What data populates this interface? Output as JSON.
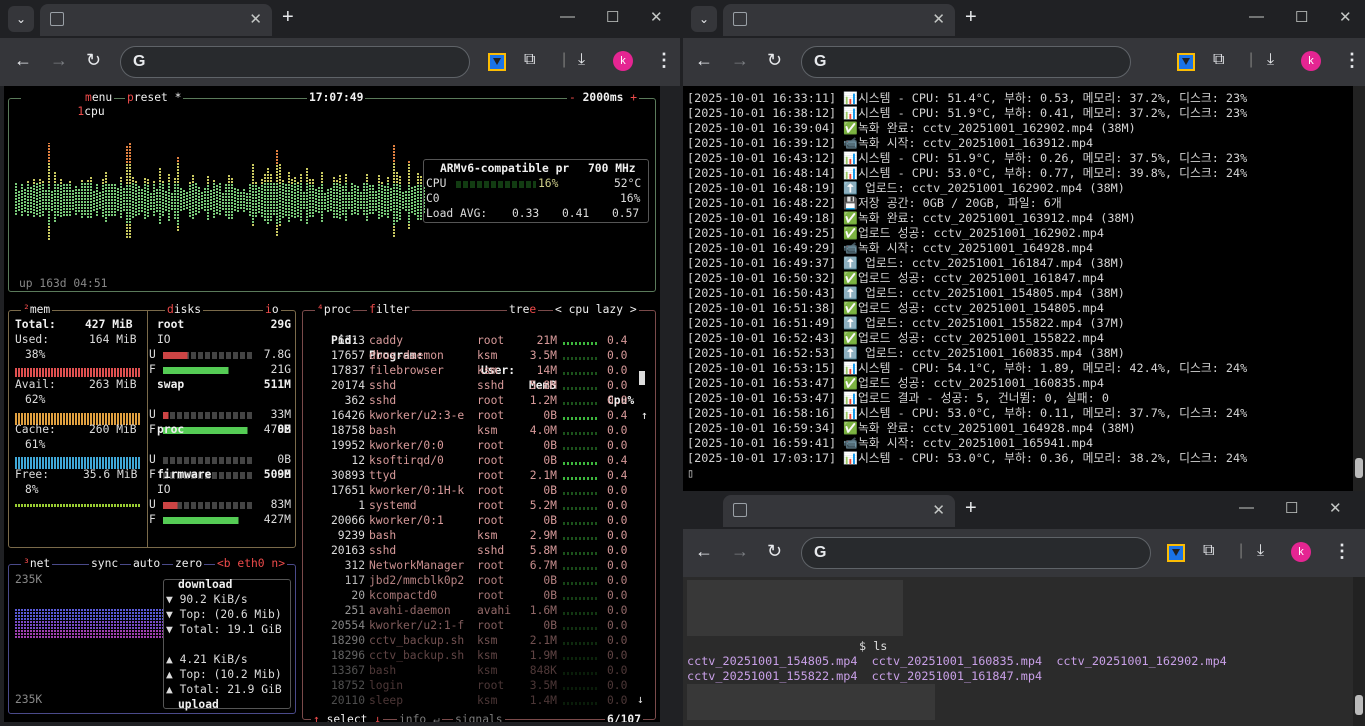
{
  "left_window": {
    "tab_title": "",
    "url": "",
    "avatar_letter": "k",
    "btop": {
      "cpu_header": {
        "box": "cpu",
        "menu": "menu",
        "preset": "preset *",
        "clock": "17:07:49",
        "interval": "2000ms",
        "minus": "-",
        "plus": "+",
        "num": "1"
      },
      "uptime": "up 163d 04:51",
      "cpu_info": {
        "model": "ARMv6-compatible pr",
        "freq": "700 MHz",
        "cpu_label": "CPU",
        "cpu_pct": "16%",
        "cpu_temp": "52°C",
        "c0_label": "C0",
        "c0_pct": "16%",
        "load_label": "Load AVG:",
        "load": [
          "0.33",
          "0.41",
          "0.57"
        ]
      },
      "mem": {
        "num": "²",
        "title": "mem",
        "total_label": "Total:",
        "total": "427 MiB",
        "used_label": "Used:",
        "used": "164 MiB",
        "used_pct": "38%",
        "avail_label": "Avail:",
        "avail": "263 MiB",
        "avail_pct": "62%",
        "cache_label": "Cache:",
        "cache": "260 MiB",
        "cache_pct": "61%",
        "free_label": "Free:",
        "free": "35.6 MiB",
        "free_pct": "8%",
        "fractions": {
          "used": 0.38,
          "avail": 0.62,
          "cache": 0.61,
          "free": 0.08
        }
      },
      "disks": {
        "title": "disks",
        "io": "io",
        "items": [
          {
            "name": "root",
            "size": "29G",
            "io": "IO",
            "u_label": "U",
            "used": "7.8G",
            "f_label": "F",
            "free": "21G",
            "used_frac": 0.27
          },
          {
            "name": "swap",
            "size": "511M",
            "io": "",
            "u_label": "U",
            "used": "33M",
            "f_label": "F",
            "free": "478M",
            "used_frac": 0.06
          },
          {
            "name": "proc",
            "size": "0B",
            "io": "",
            "u_label": "U",
            "used": "0B",
            "f_label": "F",
            "free": "0B",
            "used_frac": 0.0
          },
          {
            "name": "firmware",
            "size": "509M",
            "io": "IO",
            "u_label": "U",
            "used": "83M",
            "f_label": "F",
            "free": "427M",
            "used_frac": 0.16
          }
        ]
      },
      "net": {
        "num": "³",
        "title": "net",
        "sync": "sync",
        "auto": "auto",
        "zero": "zero",
        "iface": "<b eth0 n>",
        "scale_top": "235K",
        "scale_bottom": "235K",
        "download_label": "download",
        "down_rate": "▼ 90.2 KiB/s",
        "down_top": "▼ Top: (20.6 Mib)",
        "down_total": "▼ Total: 19.1 GiB",
        "up_rate": "▲ 4.21 KiB/s",
        "up_top": "▲ Top: (10.2 Mib)",
        "up_total": "▲ Total: 21.9 GiB",
        "upload_label": "upload"
      },
      "proc": {
        "num": "⁴",
        "title": "proc",
        "filter": "filter",
        "tree": "tree",
        "sort": "< cpu lazy >",
        "headers": {
          "pid": "Pid:",
          "program": "Program:",
          "user": "User:",
          "mem": "MemB",
          "cpu": "Cpu%"
        },
        "rows": [
          {
            "pid": "6313",
            "program": "caddy",
            "user": "root",
            "mem": "21M",
            "cpu": "0.4"
          },
          {
            "pid": "17657",
            "program": "dbus-daemon",
            "user": "ksm",
            "mem": "3.5M",
            "cpu": "0.0"
          },
          {
            "pid": "17837",
            "program": "filebrowser",
            "user": "ksm",
            "mem": "14M",
            "cpu": "0.0"
          },
          {
            "pid": "20174",
            "program": "sshd",
            "user": "sshd",
            "mem": "5.8M",
            "cpu": "0.0"
          },
          {
            "pid": "362",
            "program": "sshd",
            "user": "root",
            "mem": "1.2M",
            "cpu": "0.0"
          },
          {
            "pid": "16426",
            "program": "kworker/u2:3-e",
            "user": "root",
            "mem": "0B",
            "cpu": "0.4"
          },
          {
            "pid": "18758",
            "program": "bash",
            "user": "ksm",
            "mem": "4.0M",
            "cpu": "0.0"
          },
          {
            "pid": "19952",
            "program": "kworker/0:0",
            "user": "root",
            "mem": "0B",
            "cpu": "0.0"
          },
          {
            "pid": "12",
            "program": "ksoftirqd/0",
            "user": "root",
            "mem": "0B",
            "cpu": "0.4"
          },
          {
            "pid": "30893",
            "program": "ttyd",
            "user": "root",
            "mem": "2.1M",
            "cpu": "0.4"
          },
          {
            "pid": "17651",
            "program": "kworker/0:1H-k",
            "user": "root",
            "mem": "0B",
            "cpu": "0.0"
          },
          {
            "pid": "1",
            "program": "systemd",
            "user": "root",
            "mem": "5.2M",
            "cpu": "0.0"
          },
          {
            "pid": "20066",
            "program": "kworker/0:1",
            "user": "root",
            "mem": "0B",
            "cpu": "0.0"
          },
          {
            "pid": "9239",
            "program": "bash",
            "user": "ksm",
            "mem": "2.9M",
            "cpu": "0.0"
          },
          {
            "pid": "20163",
            "program": "sshd",
            "user": "sshd",
            "mem": "5.8M",
            "cpu": "0.0"
          },
          {
            "pid": "312",
            "program": "NetworkManager",
            "user": "root",
            "mem": "6.7M",
            "cpu": "0.0"
          },
          {
            "pid": "117",
            "program": "jbd2/mmcblk0p2",
            "user": "root",
            "mem": "0B",
            "cpu": "0.0"
          },
          {
            "pid": "20",
            "program": "kcompactd0",
            "user": "root",
            "mem": "0B",
            "cpu": "0.0"
          },
          {
            "pid": "251",
            "program": "avahi-daemon",
            "user": "avahi",
            "mem": "1.6M",
            "cpu": "0.0"
          },
          {
            "pid": "20554",
            "program": "kworker/u2:1-f",
            "user": "root",
            "mem": "0B",
            "cpu": "0.0"
          },
          {
            "pid": "18290",
            "program": "cctv_backup.sh",
            "user": "ksm",
            "mem": "2.1M",
            "cpu": "0.0"
          },
          {
            "pid": "18296",
            "program": "cctv_backup.sh",
            "user": "ksm",
            "mem": "1.9M",
            "cpu": "0.0"
          },
          {
            "pid": "13367",
            "program": "bash",
            "user": "ksm",
            "mem": "848K",
            "cpu": "0.0"
          },
          {
            "pid": "18752",
            "program": "login",
            "user": "root",
            "mem": "3.5M",
            "cpu": "0.0"
          },
          {
            "pid": "20110",
            "program": "sleep",
            "user": "ksm",
            "mem": "1.4M",
            "cpu": "0.0"
          }
        ],
        "footer_select": "select",
        "footer_info": "info",
        "footer_signals": "signals",
        "footer_count": "6/107"
      }
    }
  },
  "right_top_window": {
    "tab_title": "",
    "url": "",
    "avatar_letter": "k",
    "log_lines": [
      "[2025-10-01 16:33:11] 📊시스템 - CPU: 51.4°C, 부하: 0.53, 메모리: 37.2%, 디스크: 23%",
      "[2025-10-01 16:38:12] 📊시스템 - CPU: 51.9°C, 부하: 0.41, 메모리: 37.2%, 디스크: 23%",
      "[2025-10-01 16:39:04] ✅녹화 완료: cctv_20251001_162902.mp4 (38M)",
      "[2025-10-01 16:39:12] 📹녹화 시작: cctv_20251001_163912.mp4",
      "[2025-10-01 16:43:12] 📊시스템 - CPU: 51.9°C, 부하: 0.26, 메모리: 37.5%, 디스크: 23%",
      "[2025-10-01 16:48:14] 📊시스템 - CPU: 53.0°C, 부하: 0.77, 메모리: 39.8%, 디스크: 24%",
      "[2025-10-01 16:48:19] ⬆️ 업로드: cctv_20251001_162902.mp4 (38M)",
      "[2025-10-01 16:48:22] 💾저장 공간: 0GB / 20GB, 파일: 6개",
      "[2025-10-01 16:49:18] ✅녹화 완료: cctv_20251001_163912.mp4 (38M)",
      "[2025-10-01 16:49:25] ✅업로드 성공: cctv_20251001_162902.mp4",
      "[2025-10-01 16:49:29] 📹녹화 시작: cctv_20251001_164928.mp4",
      "[2025-10-01 16:49:37] ⬆️ 업로드: cctv_20251001_161847.mp4 (38M)",
      "[2025-10-01 16:50:32] ✅업로드 성공: cctv_20251001_161847.mp4",
      "[2025-10-01 16:50:43] ⬆️ 업로드: cctv_20251001_154805.mp4 (38M)",
      "[2025-10-01 16:51:38] ✅업로드 성공: cctv_20251001_154805.mp4",
      "[2025-10-01 16:51:49] ⬆️ 업로드: cctv_20251001_155822.mp4 (37M)",
      "[2025-10-01 16:52:43] ✅업로드 성공: cctv_20251001_155822.mp4",
      "[2025-10-01 16:52:53] ⬆️ 업로드: cctv_20251001_160835.mp4 (38M)",
      "[2025-10-01 16:53:15] 📊시스템 - CPU: 54.1°C, 부하: 1.89, 메모리: 42.4%, 디스크: 24%",
      "[2025-10-01 16:53:47] ✅업로드 성공: cctv_20251001_160835.mp4",
      "[2025-10-01 16:53:47] 📊업로드 결과 - 성공: 5, 건너뜀: 0, 실패: 0",
      "[2025-10-01 16:58:16] 📊시스템 - CPU: 53.0°C, 부하: 0.11, 메모리: 37.7%, 디스크: 24%",
      "[2025-10-01 16:59:34] ✅녹화 완료: cctv_20251001_164928.mp4 (38M)",
      "[2025-10-01 16:59:41] 📹녹화 시작: cctv_20251001_165941.mp4",
      "[2025-10-01 17:03:17] 📊시스템 - CPU: 53.0°C, 부하: 0.36, 메모리: 38.2%, 디스크: 24%"
    ]
  },
  "right_bottom_window": {
    "tab_title": "",
    "url": "",
    "avatar_letter": "k",
    "prompt": "$ ls",
    "files_row1": "cctv_20251001_154805.mp4  cctv_20251001_160835.mp4  cctv_20251001_162902.mp4",
    "files_row2": "cctv_20251001_155822.mp4  cctv_20251001_161847.mp4"
  },
  "icons": [
    "tab-menu-icon",
    "close-icon",
    "new-tab-icon",
    "minimize-icon",
    "maximize-icon",
    "back-icon",
    "forward-icon",
    "reload-icon",
    "google-icon",
    "extension-icon",
    "puzzle-icon",
    "download-icon",
    "more-icon"
  ],
  "colors": {
    "chrome_bg": "#202124",
    "toolbar": "#35363a",
    "avatar": "#e52592",
    "accent_red": "#ee4b4b"
  }
}
